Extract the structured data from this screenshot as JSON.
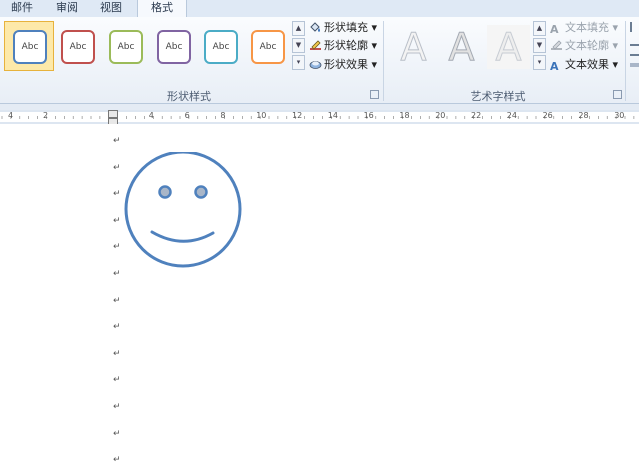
{
  "tabs": [
    {
      "label": "邮件",
      "active": false
    },
    {
      "label": "审阅",
      "active": false
    },
    {
      "label": "视图",
      "active": false
    },
    {
      "label": "格式",
      "active": true
    }
  ],
  "shape_styles": {
    "group_label": "形状样式",
    "swatches": [
      {
        "label": "Abc",
        "color": "#4f81bd",
        "selected": true
      },
      {
        "label": "Abc",
        "color": "#c0504d",
        "selected": false
      },
      {
        "label": "Abc",
        "color": "#9bbb59",
        "selected": false
      },
      {
        "label": "Abc",
        "color": "#8064a2",
        "selected": false
      },
      {
        "label": "Abc",
        "color": "#4bacc6",
        "selected": false
      },
      {
        "label": "Abc",
        "color": "#f79646",
        "selected": false
      }
    ],
    "commands": [
      {
        "label": "形状填充",
        "icon": "paint-bucket-icon"
      },
      {
        "label": "形状轮廓",
        "icon": "pencil-outline-icon"
      },
      {
        "label": "形状效果",
        "icon": "shape-effects-icon"
      }
    ]
  },
  "wordart_styles": {
    "group_label": "艺术字样式",
    "samples": [
      "A",
      "A",
      "A"
    ],
    "commands": [
      {
        "label": "文本填充",
        "icon": "text-fill-icon",
        "enabled": false
      },
      {
        "label": "文本轮廓",
        "icon": "text-outline-icon",
        "enabled": false
      },
      {
        "label": "文本效果",
        "icon": "text-effects-icon",
        "enabled": true
      }
    ]
  },
  "ruler": {
    "left_labels": [
      "4",
      "2"
    ],
    "labels": [
      "2",
      "4",
      "6",
      "8",
      "10",
      "12",
      "14",
      "16",
      "18",
      "20",
      "22",
      "24",
      "26",
      "28",
      "30"
    ]
  },
  "document": {
    "paragraph_mark": "↵",
    "shape_color": "#4f81bd",
    "eye_fill": "#a9b6c8"
  }
}
